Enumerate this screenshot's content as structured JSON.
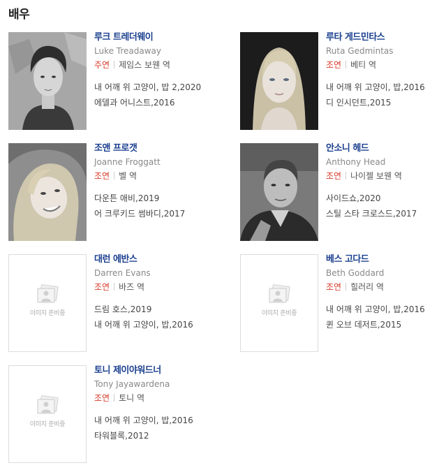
{
  "section": {
    "title": "배우"
  },
  "placeholder_text": "이미지 준비중",
  "cast": [
    {
      "name_ko": "루크 트레더웨이",
      "name_en": "Luke Treadaway",
      "role_type": "주연",
      "role": "제임스 보웬 역",
      "works": [
        "내 어깨 위 고양이, 밥 2,2020",
        "에델과 어니스트,2016"
      ]
    },
    {
      "name_ko": "루타 게드민타스",
      "name_en": "Ruta Gedmintas",
      "role_type": "조연",
      "role": "베티 역",
      "works": [
        "내 어깨 위 고양이, 밥,2016",
        "디 인시던트,2015"
      ]
    },
    {
      "name_ko": "조앤 프로갯",
      "name_en": "Joanne Froggatt",
      "role_type": "조연",
      "role": "벨 역",
      "works": [
        "다운튼 애비,2019",
        "어 크루키드 썸바디,2017"
      ]
    },
    {
      "name_ko": "안소니 헤드",
      "name_en": "Anthony Head",
      "role_type": "조연",
      "role": "나이젤 보웬 역",
      "works": [
        "사이드쇼,2020",
        "스틸 스타 크로스드,2017"
      ]
    },
    {
      "name_ko": "대런 에반스",
      "name_en": "Darren Evans",
      "role_type": "조연",
      "role": "바즈 역",
      "works": [
        "드림 호스,2019",
        "내 어깨 위 고양이, 밥,2016"
      ]
    },
    {
      "name_ko": "베스 고다드",
      "name_en": "Beth Goddard",
      "role_type": "조연",
      "role": "힐러리 역",
      "works": [
        "내 어깨 위 고양이, 밥,2016",
        "퀸 오브 데저트,2015"
      ]
    },
    {
      "name_ko": "토니 제이야워드너",
      "name_en": "Tony Jayawardena",
      "role_type": "조연",
      "role": "토니 역",
      "works": [
        "내 어깨 위 고양이, 밥,2016",
        "타워블록,2012"
      ]
    }
  ]
}
